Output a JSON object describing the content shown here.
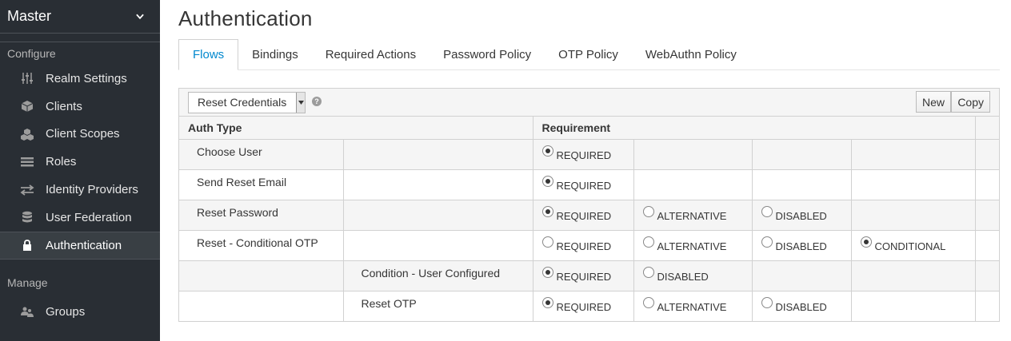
{
  "sidebar": {
    "realm": "Master",
    "configure_title": "Configure",
    "configure_items": [
      {
        "label": "Realm Settings",
        "icon": "sliders-icon"
      },
      {
        "label": "Clients",
        "icon": "cube-icon"
      },
      {
        "label": "Client Scopes",
        "icon": "cubes-icon"
      },
      {
        "label": "Roles",
        "icon": "list-icon"
      },
      {
        "label": "Identity Providers",
        "icon": "exchange-icon"
      },
      {
        "label": "User Federation",
        "icon": "database-icon"
      },
      {
        "label": "Authentication",
        "icon": "lock-icon"
      }
    ],
    "manage_title": "Manage",
    "manage_items": [
      {
        "label": "Groups",
        "icon": "users-icon"
      }
    ]
  },
  "main": {
    "title": "Authentication",
    "tabs": [
      {
        "label": "Flows",
        "active": true
      },
      {
        "label": "Bindings"
      },
      {
        "label": "Required Actions"
      },
      {
        "label": "Password Policy"
      },
      {
        "label": "OTP Policy"
      },
      {
        "label": "WebAuthn Policy"
      }
    ],
    "toolbar": {
      "flow_select": "Reset Credentials",
      "help": "?",
      "new_label": "New",
      "copy_label": "Copy"
    },
    "table": {
      "headers": {
        "auth_type": "Auth Type",
        "requirement": "Requirement"
      },
      "rows": [
        {
          "name": "Choose User",
          "sub": "",
          "options": [
            {
              "label": "REQUIRED",
              "checked": true
            }
          ]
        },
        {
          "name": "Send Reset Email",
          "sub": "",
          "options": [
            {
              "label": "REQUIRED",
              "checked": true
            }
          ]
        },
        {
          "name": "Reset Password",
          "sub": "",
          "options": [
            {
              "label": "REQUIRED",
              "checked": true
            },
            {
              "label": "ALTERNATIVE",
              "checked": false
            },
            {
              "label": "DISABLED",
              "checked": false
            }
          ]
        },
        {
          "name": "Reset - Conditional OTP",
          "sub": "",
          "options": [
            {
              "label": "REQUIRED",
              "checked": false
            },
            {
              "label": "ALTERNATIVE",
              "checked": false
            },
            {
              "label": "DISABLED",
              "checked": false
            },
            {
              "label": "CONDITIONAL",
              "checked": true
            }
          ]
        },
        {
          "name": "",
          "sub": "Condition - User Configured",
          "options": [
            {
              "label": "REQUIRED",
              "checked": true
            },
            {
              "label": "DISABLED",
              "checked": false
            }
          ]
        },
        {
          "name": "",
          "sub": "Reset OTP",
          "options": [
            {
              "label": "REQUIRED",
              "checked": true
            },
            {
              "label": "ALTERNATIVE",
              "checked": false
            },
            {
              "label": "DISABLED",
              "checked": false
            }
          ]
        }
      ]
    }
  },
  "colors": {
    "sidebar_bg": "#292e34",
    "active_tab": "#0088ce"
  }
}
